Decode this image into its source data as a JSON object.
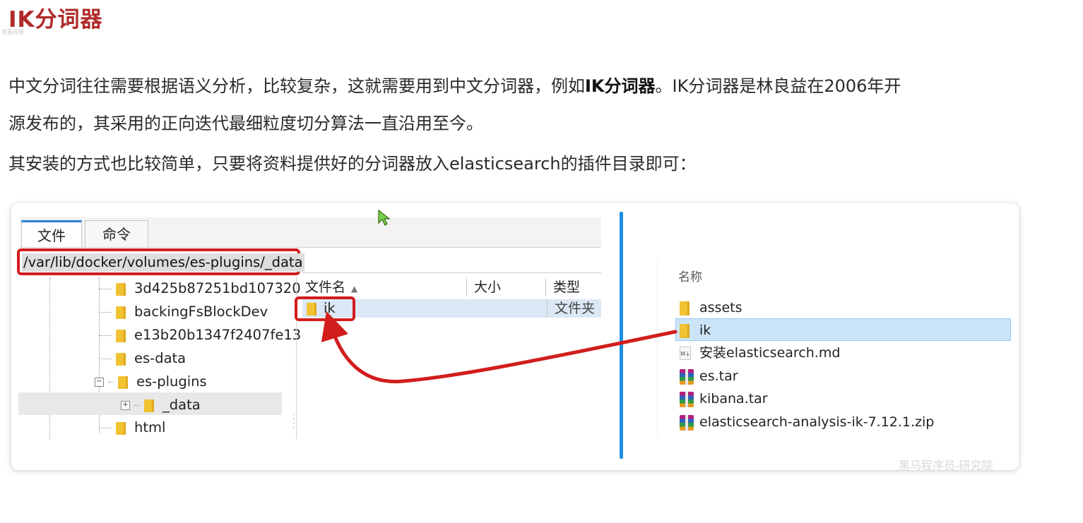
{
  "heading": "IK分词器",
  "tiny_mark": "观看视频",
  "paragraphs": {
    "p1_before": "中文分词往往需要根据语义分析，比较复杂，这就需要用到中文分词器，例如",
    "p1_bold": "IK分词器",
    "p1_after": "。IK分词器是林良益在2006年开",
    "p2": "源发布的，其采用的正向迭代最细粒度切分算法一直沿用至今。",
    "p3": "其安装的方式也比较简单，只要将资料提供好的分词器放入elasticsearch的插件目录即可："
  },
  "screenshot": {
    "tabs": [
      "文件",
      "命令"
    ],
    "path": "/var/lib/docker/volumes/es-plugins/_data",
    "tree": [
      "3d425b87251bd107320",
      "backingFsBlockDev",
      "e13b20b1347f2407fe13",
      "es-data",
      "es-plugins",
      "_data",
      "html"
    ],
    "tree_expanders": {
      "es_plugins": "−",
      "data": "+"
    },
    "list_headers": {
      "name": "文件名",
      "size": "大小",
      "type": "类型"
    },
    "list_item": {
      "name": "ik",
      "type": "文件夹"
    },
    "right_header": "名称",
    "right_items": [
      "assets",
      "ik",
      "安装elasticsearch.md",
      "es.tar",
      "kibana.tar",
      "elasticsearch-analysis-ik-7.12.1.zip"
    ],
    "md_icon_text": "M↓",
    "watermark": "黑马程序员-研究院"
  },
  "colors": {
    "heading": "#b02a2a",
    "highlight": "#d21d1d",
    "divider": "#1d8fe0",
    "selection": "#cce4f7"
  }
}
